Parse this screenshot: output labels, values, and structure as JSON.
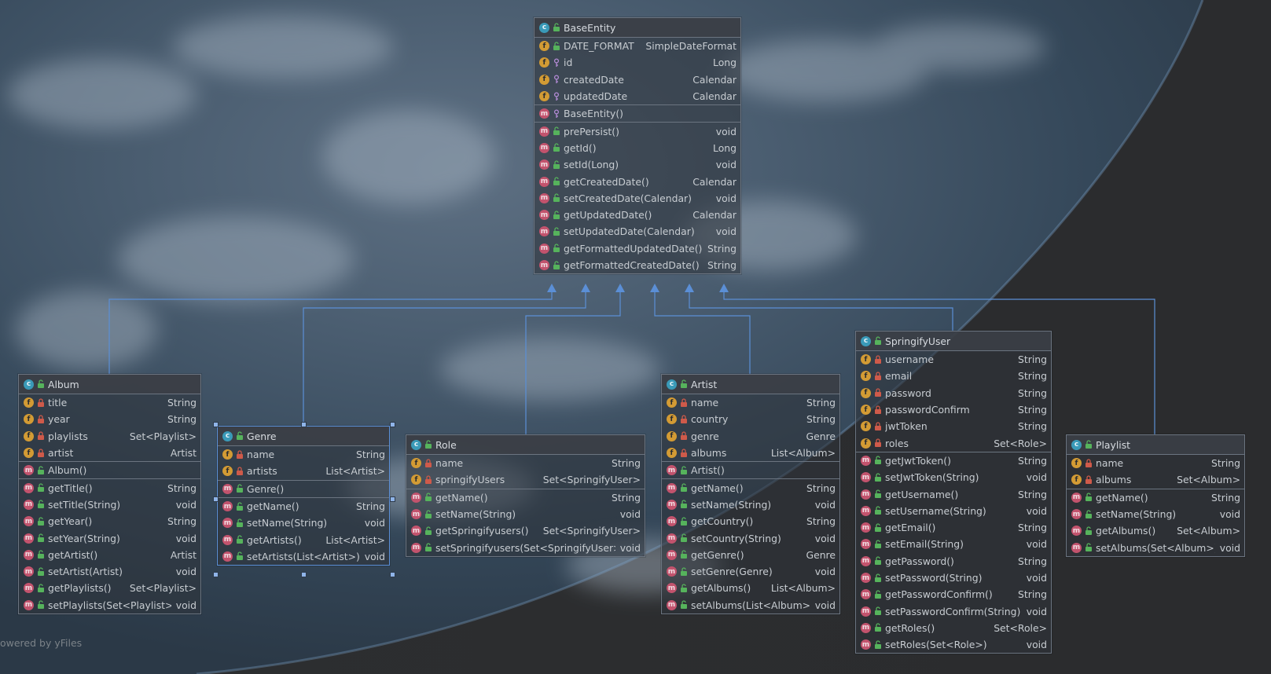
{
  "footer": "owered by yFiles",
  "nodes": {
    "BaseEntity": {
      "title": "BaseEntity",
      "fields": [
        {
          "name": "DATE_FORMAT",
          "type": "SimpleDateFormat",
          "vis": "pub",
          "static": true
        },
        {
          "name": "id",
          "type": "Long",
          "vis": "prot"
        },
        {
          "name": "createdDate",
          "type": "Calendar",
          "vis": "prot"
        },
        {
          "name": "updatedDate",
          "type": "Calendar",
          "vis": "prot"
        }
      ],
      "ctors": [
        {
          "name": "BaseEntity()",
          "type": "",
          "vis": "prot"
        }
      ],
      "methods": [
        {
          "name": "prePersist()",
          "type": "void",
          "vis": "pub"
        },
        {
          "name": "getId()",
          "type": "Long",
          "vis": "pub"
        },
        {
          "name": "setId(Long)",
          "type": "void",
          "vis": "pub"
        },
        {
          "name": "getCreatedDate()",
          "type": "Calendar",
          "vis": "pub"
        },
        {
          "name": "setCreatedDate(Calendar)",
          "type": "void",
          "vis": "pub"
        },
        {
          "name": "getUpdatedDate()",
          "type": "Calendar",
          "vis": "pub"
        },
        {
          "name": "setUpdatedDate(Calendar)",
          "type": "void",
          "vis": "pub"
        },
        {
          "name": "getFormattedUpdatedDate()",
          "type": "String",
          "vis": "pub"
        },
        {
          "name": "getFormattedCreatedDate()",
          "type": "String",
          "vis": "pub"
        }
      ]
    },
    "Album": {
      "title": "Album",
      "fields": [
        {
          "name": "title",
          "type": "String",
          "vis": "priv"
        },
        {
          "name": "year",
          "type": "String",
          "vis": "priv"
        },
        {
          "name": "playlists",
          "type": "Set<Playlist>",
          "vis": "priv"
        },
        {
          "name": "artist",
          "type": "Artist",
          "vis": "priv"
        }
      ],
      "ctors": [
        {
          "name": "Album()",
          "type": "",
          "vis": "pub"
        }
      ],
      "methods": [
        {
          "name": "getTitle()",
          "type": "String",
          "vis": "pub"
        },
        {
          "name": "setTitle(String)",
          "type": "void",
          "vis": "pub"
        },
        {
          "name": "getYear()",
          "type": "String",
          "vis": "pub"
        },
        {
          "name": "setYear(String)",
          "type": "void",
          "vis": "pub"
        },
        {
          "name": "getArtist()",
          "type": "Artist",
          "vis": "pub"
        },
        {
          "name": "setArtist(Artist)",
          "type": "void",
          "vis": "pub"
        },
        {
          "name": "getPlaylists()",
          "type": "Set<Playlist>",
          "vis": "pub"
        },
        {
          "name": "setPlaylists(Set<Playlist>)",
          "type": "void",
          "vis": "pub"
        }
      ]
    },
    "Genre": {
      "title": "Genre",
      "fields": [
        {
          "name": "name",
          "type": "String",
          "vis": "priv"
        },
        {
          "name": "artists",
          "type": "List<Artist>",
          "vis": "priv"
        }
      ],
      "ctors": [
        {
          "name": "Genre()",
          "type": "",
          "vis": "pub"
        }
      ],
      "methods": [
        {
          "name": "getName()",
          "type": "String",
          "vis": "pub"
        },
        {
          "name": "setName(String)",
          "type": "void",
          "vis": "pub"
        },
        {
          "name": "getArtists()",
          "type": "List<Artist>",
          "vis": "pub"
        },
        {
          "name": "setArtists(List<Artist>)",
          "type": "void",
          "vis": "pub"
        }
      ]
    },
    "Role": {
      "title": "Role",
      "fields": [
        {
          "name": "name",
          "type": "String",
          "vis": "priv"
        },
        {
          "name": "springifyUsers",
          "type": "Set<SpringifyUser>",
          "vis": "priv"
        }
      ],
      "ctors": [],
      "methods": [
        {
          "name": "getName()",
          "type": "String",
          "vis": "pub"
        },
        {
          "name": "setName(String)",
          "type": "void",
          "vis": "pub"
        },
        {
          "name": "getSpringifyusers()",
          "type": "Set<SpringifyUser>",
          "vis": "pub"
        },
        {
          "name": "setSpringifyusers(Set<SpringifyUser>)",
          "type": "void",
          "vis": "pub"
        }
      ]
    },
    "Artist": {
      "title": "Artist",
      "fields": [
        {
          "name": "name",
          "type": "String",
          "vis": "priv"
        },
        {
          "name": "country",
          "type": "String",
          "vis": "priv"
        },
        {
          "name": "genre",
          "type": "Genre",
          "vis": "priv"
        },
        {
          "name": "albums",
          "type": "List<Album>",
          "vis": "priv"
        }
      ],
      "ctors": [
        {
          "name": "Artist()",
          "type": "",
          "vis": "pub"
        }
      ],
      "methods": [
        {
          "name": "getName()",
          "type": "String",
          "vis": "pub"
        },
        {
          "name": "setName(String)",
          "type": "void",
          "vis": "pub"
        },
        {
          "name": "getCountry()",
          "type": "String",
          "vis": "pub"
        },
        {
          "name": "setCountry(String)",
          "type": "void",
          "vis": "pub"
        },
        {
          "name": "getGenre()",
          "type": "Genre",
          "vis": "pub"
        },
        {
          "name": "setGenre(Genre)",
          "type": "void",
          "vis": "pub"
        },
        {
          "name": "getAlbums()",
          "type": "List<Album>",
          "vis": "pub"
        },
        {
          "name": "setAlbums(List<Album>)",
          "type": "void",
          "vis": "pub"
        }
      ]
    },
    "SpringifyUser": {
      "title": "SpringifyUser",
      "fields": [
        {
          "name": "username",
          "type": "String",
          "vis": "priv"
        },
        {
          "name": "email",
          "type": "String",
          "vis": "priv"
        },
        {
          "name": "password",
          "type": "String",
          "vis": "priv"
        },
        {
          "name": "passwordConfirm",
          "type": "String",
          "vis": "priv"
        },
        {
          "name": "jwtToken",
          "type": "String",
          "vis": "priv"
        },
        {
          "name": "roles",
          "type": "Set<Role>",
          "vis": "priv"
        }
      ],
      "ctors": [],
      "methods": [
        {
          "name": "getJwtToken()",
          "type": "String",
          "vis": "pub"
        },
        {
          "name": "setJwtToken(String)",
          "type": "void",
          "vis": "pub"
        },
        {
          "name": "getUsername()",
          "type": "String",
          "vis": "pub"
        },
        {
          "name": "setUsername(String)",
          "type": "void",
          "vis": "pub"
        },
        {
          "name": "getEmail()",
          "type": "String",
          "vis": "pub"
        },
        {
          "name": "setEmail(String)",
          "type": "void",
          "vis": "pub"
        },
        {
          "name": "getPassword()",
          "type": "String",
          "vis": "pub"
        },
        {
          "name": "setPassword(String)",
          "type": "void",
          "vis": "pub"
        },
        {
          "name": "getPasswordConfirm()",
          "type": "String",
          "vis": "pub"
        },
        {
          "name": "setPasswordConfirm(String)",
          "type": "void",
          "vis": "pub"
        },
        {
          "name": "getRoles()",
          "type": "Set<Role>",
          "vis": "pub"
        },
        {
          "name": "setRoles(Set<Role>)",
          "type": "void",
          "vis": "pub"
        }
      ]
    },
    "Playlist": {
      "title": "Playlist",
      "fields": [
        {
          "name": "name",
          "type": "String",
          "vis": "priv"
        },
        {
          "name": "albums",
          "type": "Set<Album>",
          "vis": "priv"
        }
      ],
      "ctors": [],
      "methods": [
        {
          "name": "getName()",
          "type": "String",
          "vis": "pub"
        },
        {
          "name": "setName(String)",
          "type": "void",
          "vis": "pub"
        },
        {
          "name": "getAlbums()",
          "type": "Set<Album>",
          "vis": "pub"
        },
        {
          "name": "setAlbums(Set<Album>)",
          "type": "void",
          "vis": "pub"
        }
      ]
    }
  },
  "colors": {
    "edge": "#5b8fd6",
    "node_border": "#6b7480",
    "class_icon": "#3a9ab8",
    "field_icon": "#d39b34",
    "method_icon": "#c2536d",
    "public": "#56b35c",
    "private": "#cf5a4a"
  },
  "icons": {
    "class": "class-icon",
    "field": "field-icon",
    "method": "method-icon",
    "public": "unlocked-icon",
    "private": "lock-icon",
    "protected": "key-icon"
  }
}
